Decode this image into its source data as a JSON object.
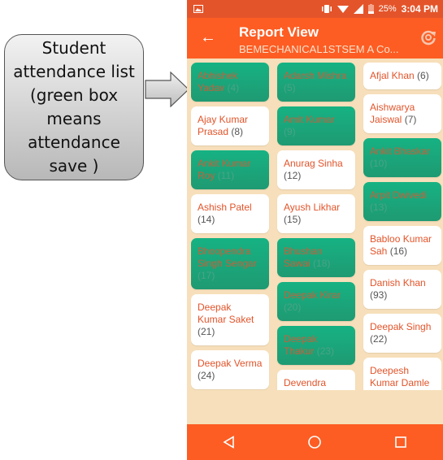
{
  "callout": {
    "text": "Student attendance list (green box means attendance save )"
  },
  "status_bar": {
    "battery": "25%",
    "time": "3:04 PM"
  },
  "toolbar": {
    "title": "Report View",
    "subtitle": "BEMECHANICAL1STSEM A Co...",
    "back_icon": "arrow-left-icon",
    "refresh_icon": "refresh-icon"
  },
  "colors": {
    "present": "#1aa67a",
    "absent": "#ffffff",
    "accent": "#fd5d23",
    "background": "#f6dfba"
  },
  "columns": [
    [
      {
        "name": "Abhishek Yadav",
        "roll": "(4)",
        "present": true
      },
      {
        "name": "Ajay Kumar Prasad",
        "roll": "(8)",
        "present": false
      },
      {
        "name": "Ankit Kumar Roy",
        "roll": "(11)",
        "present": true
      },
      {
        "name": "Ashish Patel",
        "roll": "(14)",
        "present": false
      },
      {
        "name": "Bhoopendra Singh Sengar",
        "roll": "(17)",
        "present": true
      },
      {
        "name": "Deepak Kumar Saket",
        "roll": "(21)",
        "present": false
      },
      {
        "name": "Deepak Verma",
        "roll": "(24)",
        "present": false
      }
    ],
    [
      {
        "name": "Adarsh Mishra",
        "roll": "(5)",
        "present": true
      },
      {
        "name": "Amit Kumar",
        "roll": "(9)",
        "present": true
      },
      {
        "name": "Anurag Sinha",
        "roll": "(12)",
        "present": false
      },
      {
        "name": "Ayush Likhar",
        "roll": "(15)",
        "present": false
      },
      {
        "name": "Bhushan Sawai",
        "roll": "(18)",
        "present": true
      },
      {
        "name": "Deepak Kirar",
        "roll": "(20)",
        "present": true
      },
      {
        "name": "Deepak Thakur",
        "roll": "(23)",
        "present": true
      },
      {
        "name": "Devendra Pratap Singh",
        "roll": "",
        "present": false
      }
    ],
    [
      {
        "name": "Afjal Khan",
        "roll": "(6)",
        "present": false
      },
      {
        "name": "Aishwarya Jaiswal",
        "roll": "(7)",
        "present": false
      },
      {
        "name": "Ankit Bhaskar",
        "roll": "(10)",
        "present": true
      },
      {
        "name": "Arpit Dwivedi",
        "roll": "(13)",
        "present": true
      },
      {
        "name": "Babloo Kumar Sah",
        "roll": "(16)",
        "present": false
      },
      {
        "name": "Danish Khan",
        "roll": "(93)",
        "present": false
      },
      {
        "name": "Deepak Singh",
        "roll": "(22)",
        "present": false
      },
      {
        "name": "Deepesh Kumar Damle",
        "roll": "",
        "present": false
      }
    ]
  ],
  "nav_bar": {
    "icons": [
      "back-triangle-icon",
      "home-circle-icon",
      "recents-square-icon"
    ]
  }
}
